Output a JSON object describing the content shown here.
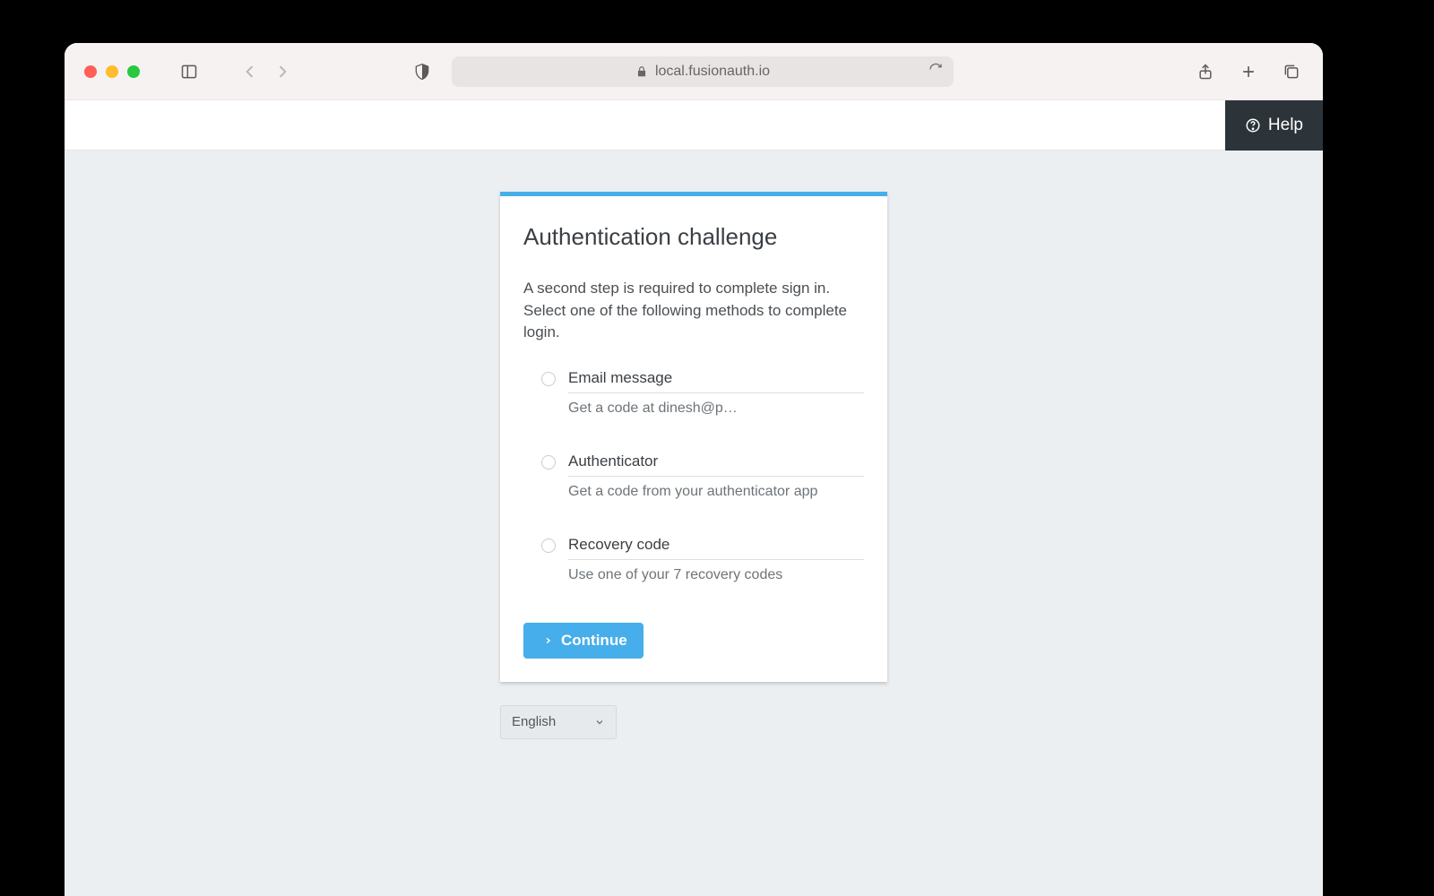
{
  "browser": {
    "url_display": "local.fusionauth.io"
  },
  "topbar": {
    "help_label": "Help"
  },
  "card": {
    "title": "Authentication challenge",
    "description": "A second step is required to complete sign in. Select one of the following methods to complete login.",
    "options": [
      {
        "title": "Email message",
        "description": "Get a code at dinesh@p…"
      },
      {
        "title": "Authenticator",
        "description": "Get a code from your authenticator app"
      },
      {
        "title": "Recovery code",
        "description": "Use one of your 7 recovery codes"
      }
    ],
    "continue_label": "Continue"
  },
  "language": {
    "selected": "English"
  }
}
